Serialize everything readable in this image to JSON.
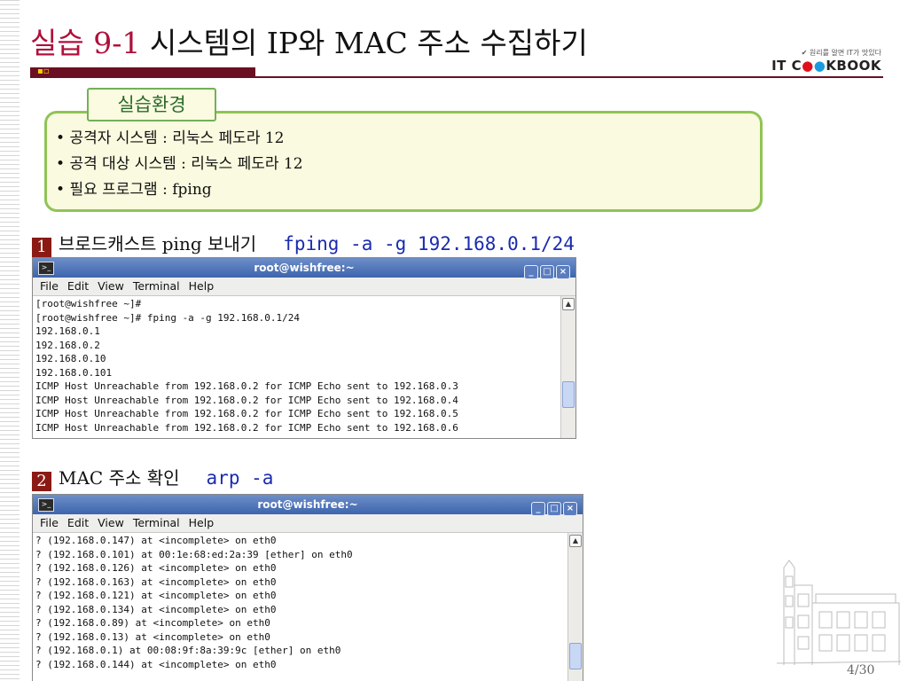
{
  "slide": {
    "title_accent": "실습 9-1",
    "title_main": " 시스템의 IP와 MAC 주소 수집하기",
    "logo_tagline": "원리를 알면 IT가 맛있다",
    "logo_prefix": "IT C",
    "logo_o1": "●",
    "logo_o2": "●",
    "logo_suffix": "KBOOK",
    "page_number": "4/30"
  },
  "environment": {
    "heading": "실습환경",
    "items": [
      "공격자 시스템 : 리눅스 페도라 12",
      "공격 대상 시스템 : 리눅스 페도라 12",
      "필요 프로그램 : fping"
    ]
  },
  "steps": [
    {
      "number": "1",
      "label": "브로드캐스트 ping 보내기",
      "command": "fping -a -g 192.168.0.1/24"
    },
    {
      "number": "2",
      "label": "MAC 주소 확인",
      "command": "arp -a"
    }
  ],
  "terminal_windows": [
    {
      "title": "root@wishfree:~",
      "menu": [
        "File",
        "Edit",
        "View",
        "Terminal",
        "Help"
      ],
      "lines": [
        "[root@wishfree ~]#",
        "[root@wishfree ~]# fping -a -g 192.168.0.1/24",
        "192.168.0.1",
        "192.168.0.2",
        "192.168.0.10",
        "192.168.0.101",
        "ICMP Host Unreachable from 192.168.0.2 for ICMP Echo sent to 192.168.0.3",
        "ICMP Host Unreachable from 192.168.0.2 for ICMP Echo sent to 192.168.0.4",
        "ICMP Host Unreachable from 192.168.0.2 for ICMP Echo sent to 192.168.0.5",
        "ICMP Host Unreachable from 192.168.0.2 for ICMP Echo sent to 192.168.0.6"
      ]
    },
    {
      "title": "root@wishfree:~",
      "menu": [
        "File",
        "Edit",
        "View",
        "Terminal",
        "Help"
      ],
      "lines": [
        "? (192.168.0.147) at <incomplete> on eth0",
        "? (192.168.0.101) at 00:1e:68:ed:2a:39 [ether] on eth0",
        "? (192.168.0.126) at <incomplete> on eth0",
        "? (192.168.0.163) at <incomplete> on eth0",
        "? (192.168.0.121) at <incomplete> on eth0",
        "? (192.168.0.134) at <incomplete> on eth0",
        "? (192.168.0.89) at <incomplete> on eth0",
        "? (192.168.0.13) at <incomplete> on eth0",
        "? (192.168.0.1) at 00:08:9f:8a:39:9c [ether] on eth0",
        "? (192.168.0.144) at <incomplete> on eth0"
      ]
    }
  ],
  "colors": {
    "title_accent": "#b0103a",
    "rule": "#6b0f23",
    "env_border": "#8fc455",
    "env_fill": "#f9fadf",
    "step_badge": "#8b1a14",
    "command": "#1a2bb0"
  }
}
